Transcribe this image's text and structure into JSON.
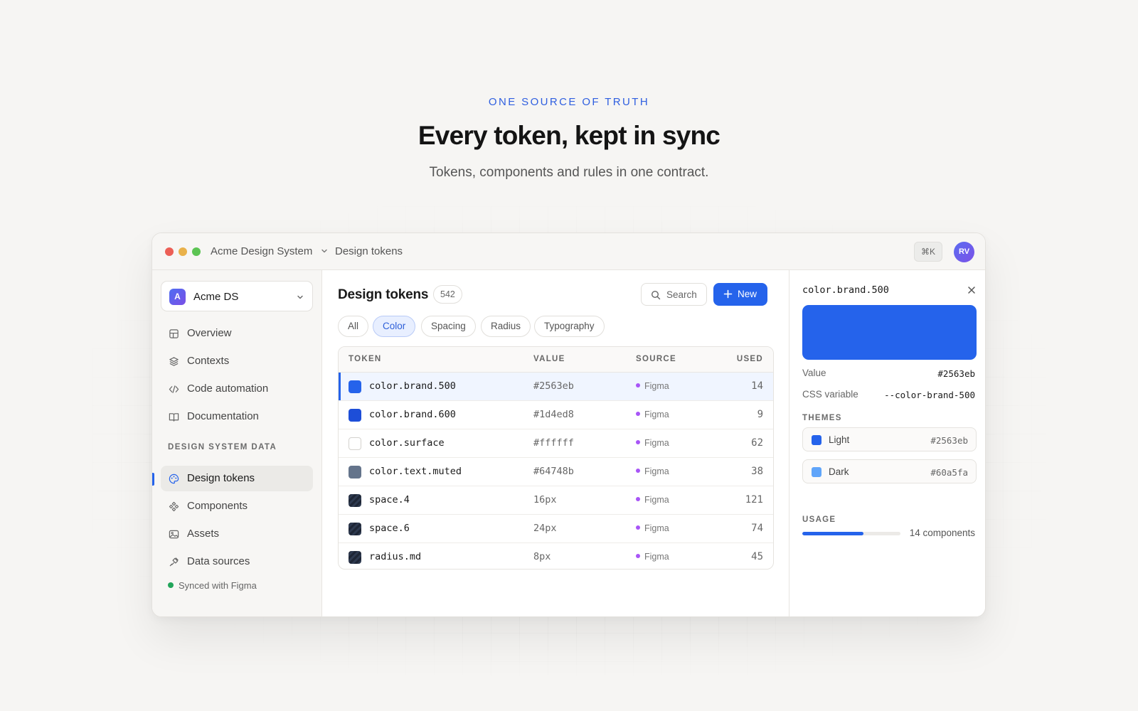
{
  "hero": {
    "eyebrow": "ONE SOURCE OF TRUTH",
    "headline": "Every token, kept in sync",
    "subline": "Tokens, components and rules in one contract."
  },
  "titlebar": {
    "workspace": "Acme Design System",
    "page": "Design tokens",
    "shortcut": "⌘K",
    "avatar_initials": "RV"
  },
  "sidebar": {
    "workspace_initial": "A",
    "workspace_name": "Acme DS",
    "primary_items": [
      {
        "label": "Overview",
        "icon": "layout-icon"
      },
      {
        "label": "Contexts",
        "icon": "layers-icon"
      },
      {
        "label": "Code automation",
        "icon": "code-icon"
      },
      {
        "label": "Documentation",
        "icon": "book-icon"
      }
    ],
    "section_label": "DESIGN SYSTEM DATA",
    "data_items": [
      {
        "label": "Design tokens",
        "icon": "palette-icon",
        "active": true
      },
      {
        "label": "Components",
        "icon": "components-icon"
      },
      {
        "label": "Assets",
        "icon": "image-icon"
      },
      {
        "label": "Data sources",
        "icon": "plug-icon"
      }
    ],
    "sync_status": "Synced with Figma"
  },
  "main": {
    "title": "Design tokens",
    "count": "542",
    "search_label": "Search",
    "new_label": "New",
    "filters": [
      "All",
      "Color",
      "Spacing",
      "Radius",
      "Typography"
    ],
    "active_filter": "Color",
    "columns": {
      "token": "TOKEN",
      "value": "VALUE",
      "source": "SOURCE",
      "used": "USED"
    },
    "rows": [
      {
        "token": "color.brand.500",
        "value": "#2563eb",
        "source": "Figma",
        "used": "14",
        "swatch": "#2563eb"
      },
      {
        "token": "color.brand.600",
        "value": "#1d4ed8",
        "source": "Figma",
        "used": "9",
        "swatch": "#1d4ed8"
      },
      {
        "token": "color.surface",
        "value": "#ffffff",
        "source": "Figma",
        "used": "62",
        "swatch": "#ffffff"
      },
      {
        "token": "color.text.muted",
        "value": "#64748b",
        "source": "Figma",
        "used": "38",
        "swatch": "#64748b"
      },
      {
        "token": "space.4",
        "value": "16px",
        "source": "Figma",
        "used": "121",
        "swatch": "pattern"
      },
      {
        "token": "space.6",
        "value": "24px",
        "source": "Figma",
        "used": "74",
        "swatch": "pattern"
      },
      {
        "token": "radius.md",
        "value": "8px",
        "source": "Figma",
        "used": "45",
        "swatch": "pattern"
      }
    ]
  },
  "detail": {
    "token": "color.brand.500",
    "preview_color": "#2563eb",
    "value_label": "Value",
    "value": "#2563eb",
    "css_label": "CSS variable",
    "css_var": "--color-brand-500",
    "themes_label": "THEMES",
    "themes": [
      {
        "name": "Light",
        "hex": "#2563eb"
      },
      {
        "name": "Dark",
        "hex": "#60a5fa"
      }
    ],
    "usage_label": "USAGE",
    "usage_text": "14 components",
    "usage_fraction": 0.62
  },
  "colors": {
    "accent": "#2563eb",
    "source_dot": "#a855f7",
    "sync_dot": "#22a55a"
  }
}
